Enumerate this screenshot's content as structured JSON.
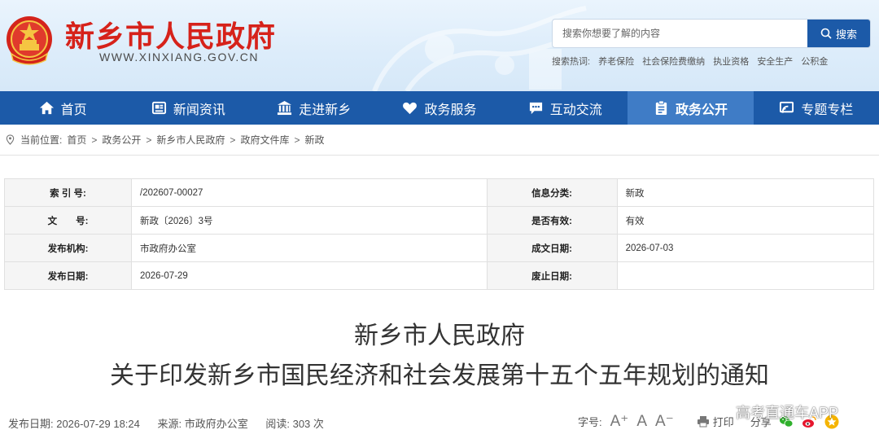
{
  "header": {
    "site_title": "新乡市人民政府",
    "site_url": "WWW.XINXIANG.GOV.CN",
    "search": {
      "placeholder": "搜索你想要了解的内容",
      "button_label": "搜索"
    },
    "hot_label": "搜索热词:",
    "hot_keywords": [
      "养老保险",
      "社会保险费缴纳",
      "执业资格",
      "安全生产",
      "公积金"
    ]
  },
  "nav": {
    "items": [
      {
        "label": "首页",
        "icon": "home-icon"
      },
      {
        "label": "新闻资讯",
        "icon": "news-icon"
      },
      {
        "label": "走进新乡",
        "icon": "building-icon"
      },
      {
        "label": "政务服务",
        "icon": "heart-icon"
      },
      {
        "label": "互动交流",
        "icon": "chat-icon"
      },
      {
        "label": "政务公开",
        "icon": "clipboard-icon",
        "active": true
      },
      {
        "label": "专题专栏",
        "icon": "cast-icon"
      }
    ]
  },
  "breadcrumb": {
    "prefix": "当前位置:",
    "items": [
      "首页",
      "政务公开",
      "新乡市人民政府",
      "政府文件库",
      "新政"
    ]
  },
  "info_table": {
    "rows": [
      {
        "l1": "索 引 号:",
        "v1": "/202607-00027",
        "l2": "信息分类:",
        "v2": "新政"
      },
      {
        "l1": "文　　号:",
        "v1": "新政〔2026〕3号",
        "l2": "是否有效:",
        "v2": "有效"
      },
      {
        "l1": "发布机构:",
        "v1": "市政府办公室",
        "l2": "成文日期:",
        "v2": "2026-07-03"
      },
      {
        "l1": "发布日期:",
        "v1": "2026-07-29",
        "l2": "废止日期:",
        "v2": ""
      }
    ]
  },
  "document": {
    "title_line1": "新乡市人民政府",
    "title_line2": "关于印发新乡市国民经济和社会发展第十五个五年规划的通知"
  },
  "meta": {
    "publish": "发布日期:  2026-07-29 18:24",
    "source": "来源: 市政府办公室",
    "views": "阅读: 303 次"
  },
  "tools": {
    "font_label": "字号:",
    "font_large": "A⁺",
    "font_normal": "A",
    "font_small": "A⁻",
    "print_label": "打印",
    "share_label": "分享"
  },
  "watermark": "高考直通车APP",
  "colors": {
    "brand_blue": "#1c5aa8",
    "active_nav": "#3f7cc6",
    "title_red": "#d6221a"
  }
}
